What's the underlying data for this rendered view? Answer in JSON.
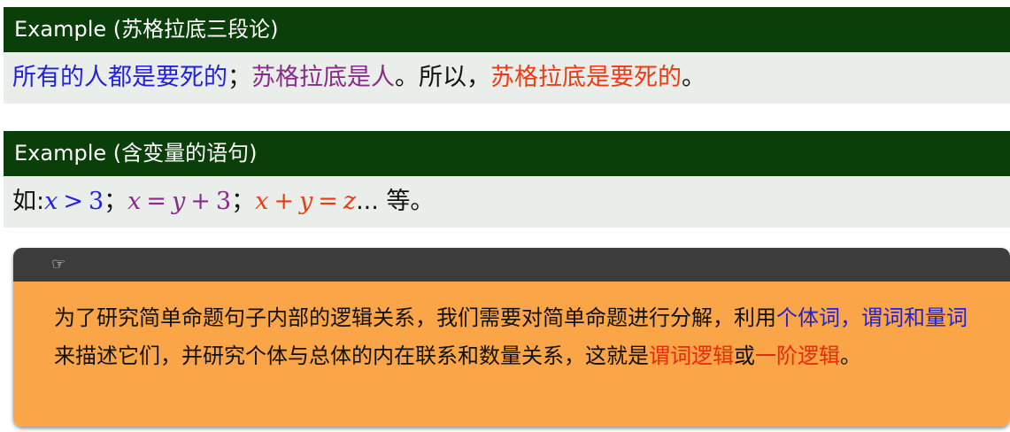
{
  "example1": {
    "title": "Example (苏格拉底三段论)",
    "parts": [
      {
        "text": "所有的人都是要死的",
        "color": "blue"
      },
      {
        "text": "；",
        "color": "black"
      },
      {
        "text": "苏格拉底是人",
        "color": "purple"
      },
      {
        "text": "。所以，",
        "color": "black"
      },
      {
        "text": "苏格拉底是要死的",
        "color": "red"
      },
      {
        "text": "。",
        "color": "black"
      }
    ]
  },
  "example2": {
    "title": "Example (含变量的语句)",
    "prefix": "如:",
    "expr1": {
      "var1": "x",
      "op1": ">",
      "num1": "3"
    },
    "sep1": "；",
    "expr2": {
      "var1": "x",
      "op1": "=",
      "var2": "y",
      "op2": "+",
      "num1": "3"
    },
    "sep2": "；",
    "expr3": {
      "var1": "x",
      "op1": "+",
      "var2": "y",
      "op2": "=",
      "var3": "z"
    },
    "ellipsis": "...",
    "suffix": " 等。"
  },
  "note": {
    "icon": "☞",
    "icon_name": "pointing-hand-icon",
    "segments": [
      {
        "text": "为了研究简单命题句子内部的逻辑关系，我们需要对简单命题进行分解，利用",
        "color": "black"
      },
      {
        "text": "个体词，谓词和量词",
        "color": "blue"
      },
      {
        "text": "来描述它们，并研究个体与总体的内在联系和数量关系，这就是",
        "color": "black"
      },
      {
        "text": "谓词逻辑",
        "color": "red"
      },
      {
        "text": "或",
        "color": "black"
      },
      {
        "text": "一阶逻辑",
        "color": "red"
      },
      {
        "text": "。",
        "color": "black"
      }
    ]
  },
  "colors": {
    "header_green": "#0a3f0a",
    "body_gray": "#eaeeea",
    "blue": "#2222dd",
    "purple": "#8a2b8a",
    "red": "#ec3c14",
    "note_header": "#3c3c3c",
    "note_body": "#f9a548"
  }
}
